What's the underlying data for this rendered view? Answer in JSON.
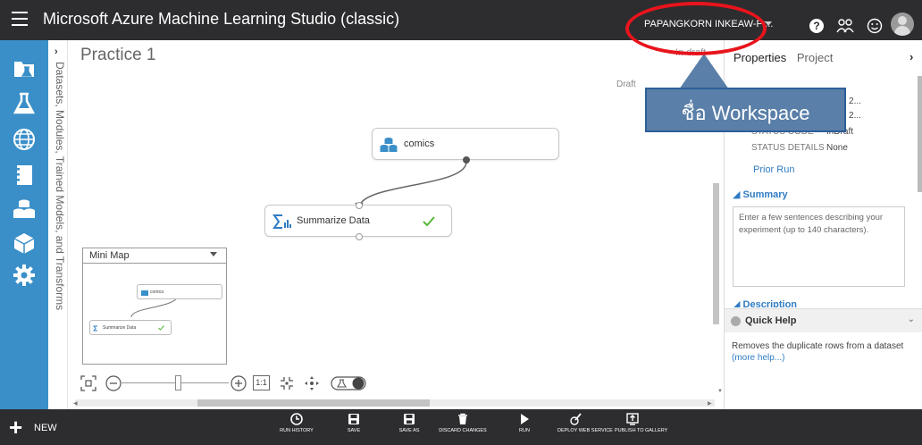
{
  "topbar": {
    "app_title": "Microsoft Azure Machine Learning Studio (classic)",
    "workspace": "PAPANGKORN INKEAW-Fr..."
  },
  "palette": {
    "label": "Datasets, Modules, Trained Models, and Transforms"
  },
  "canvas": {
    "title": "Practice 1",
    "in_draft": "In draft",
    "draft_label": "Draft",
    "nodes": [
      {
        "label": "comics"
      },
      {
        "label": "Summarize Data"
      }
    ],
    "minimap": {
      "title": "Mini Map",
      "nodes": [
        {
          "label": "comics"
        },
        {
          "label": "Summarize Data"
        }
      ]
    },
    "zoom": {
      "fit_label": "1:1"
    }
  },
  "properties": {
    "tab_properties": "Properties",
    "tab_project": "Project",
    "rows": [
      {
        "key": "",
        "value": "2019 2..."
      },
      {
        "key": "",
        "value": "2019 2..."
      },
      {
        "key": "STATUS CODE",
        "value": "InDraft"
      },
      {
        "key": "STATUS DETAILS",
        "value": "None"
      }
    ],
    "prior_run": "Prior Run",
    "summary_heading": "Summary",
    "summary_placeholder": "Enter a few sentences describing your experiment (up to 140 characters).",
    "description_heading": "Description",
    "quick_help_title": "Quick Help",
    "quick_help_text": "Removes the duplicate rows from a dataset",
    "quick_help_link": "(more help...)"
  },
  "callout": {
    "text": "ชื่อ Workspace"
  },
  "bottombar": {
    "new_label": "NEW",
    "buttons": [
      {
        "label": "RUN HISTORY",
        "icon": "history-icon"
      },
      {
        "label": "SAVE",
        "icon": "save-icon"
      },
      {
        "label": "SAVE AS",
        "icon": "save-as-icon"
      },
      {
        "label": "DISCARD CHANGES",
        "icon": "trash-icon"
      },
      {
        "label": "RUN",
        "icon": "run-icon"
      },
      {
        "label": "DEPLOY WEB SERVICE",
        "icon": "deploy-icon"
      },
      {
        "label": "PUBLISH TO GALLERY",
        "icon": "publish-icon"
      }
    ]
  },
  "colors": {
    "topbar": "#2d2d30",
    "leftnav": "#3a8fc8",
    "accent": "#2f7cc4",
    "highlight": "#e8141c",
    "callout": "#5a7fa8",
    "success": "#56b63b"
  }
}
